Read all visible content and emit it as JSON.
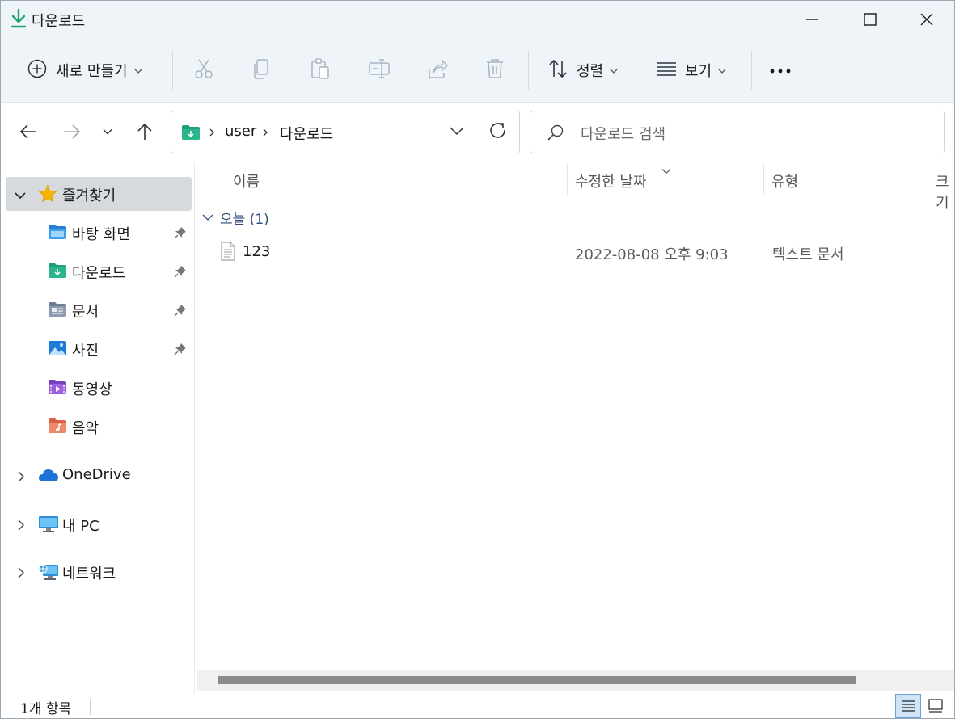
{
  "window": {
    "title": "다운로드"
  },
  "commandbar": {
    "new_label": "새로 만들기",
    "sort_label": "정렬",
    "view_label": "보기"
  },
  "address": {
    "crumbs": [
      "user",
      "다운로드"
    ],
    "search_placeholder": "다운로드 검색"
  },
  "sidebar": {
    "quick_access": {
      "label": "즐겨찾기",
      "items": [
        {
          "label": "바탕 화면",
          "icon": "desktop-folder-icon",
          "pinned": true
        },
        {
          "label": "다운로드",
          "icon": "downloads-folder-icon",
          "pinned": true
        },
        {
          "label": "문서",
          "icon": "documents-folder-icon",
          "pinned": true
        },
        {
          "label": "사진",
          "icon": "pictures-folder-icon",
          "pinned": true
        },
        {
          "label": "동영상",
          "icon": "videos-folder-icon",
          "pinned": false
        },
        {
          "label": "음악",
          "icon": "music-folder-icon",
          "pinned": false
        }
      ]
    },
    "roots": [
      {
        "label": "OneDrive",
        "icon": "onedrive-cloud-icon"
      },
      {
        "label": "내 PC",
        "icon": "this-pc-icon"
      },
      {
        "label": "네트워크",
        "icon": "network-icon"
      }
    ]
  },
  "list": {
    "columns": [
      "이름",
      "수정한 날짜",
      "유형",
      "크기"
    ],
    "group_label": "오늘 (1)",
    "rows": [
      {
        "name": "123",
        "modified": "2022-08-08 오후 9:03",
        "type": "텍스트 문서",
        "icon": "text-file-icon"
      }
    ]
  },
  "status": {
    "item_count": "1개 항목"
  },
  "colors": {
    "title_bg": "#eff4f9",
    "selection_bg": "#d7dadd",
    "accent": "#0067c0"
  }
}
